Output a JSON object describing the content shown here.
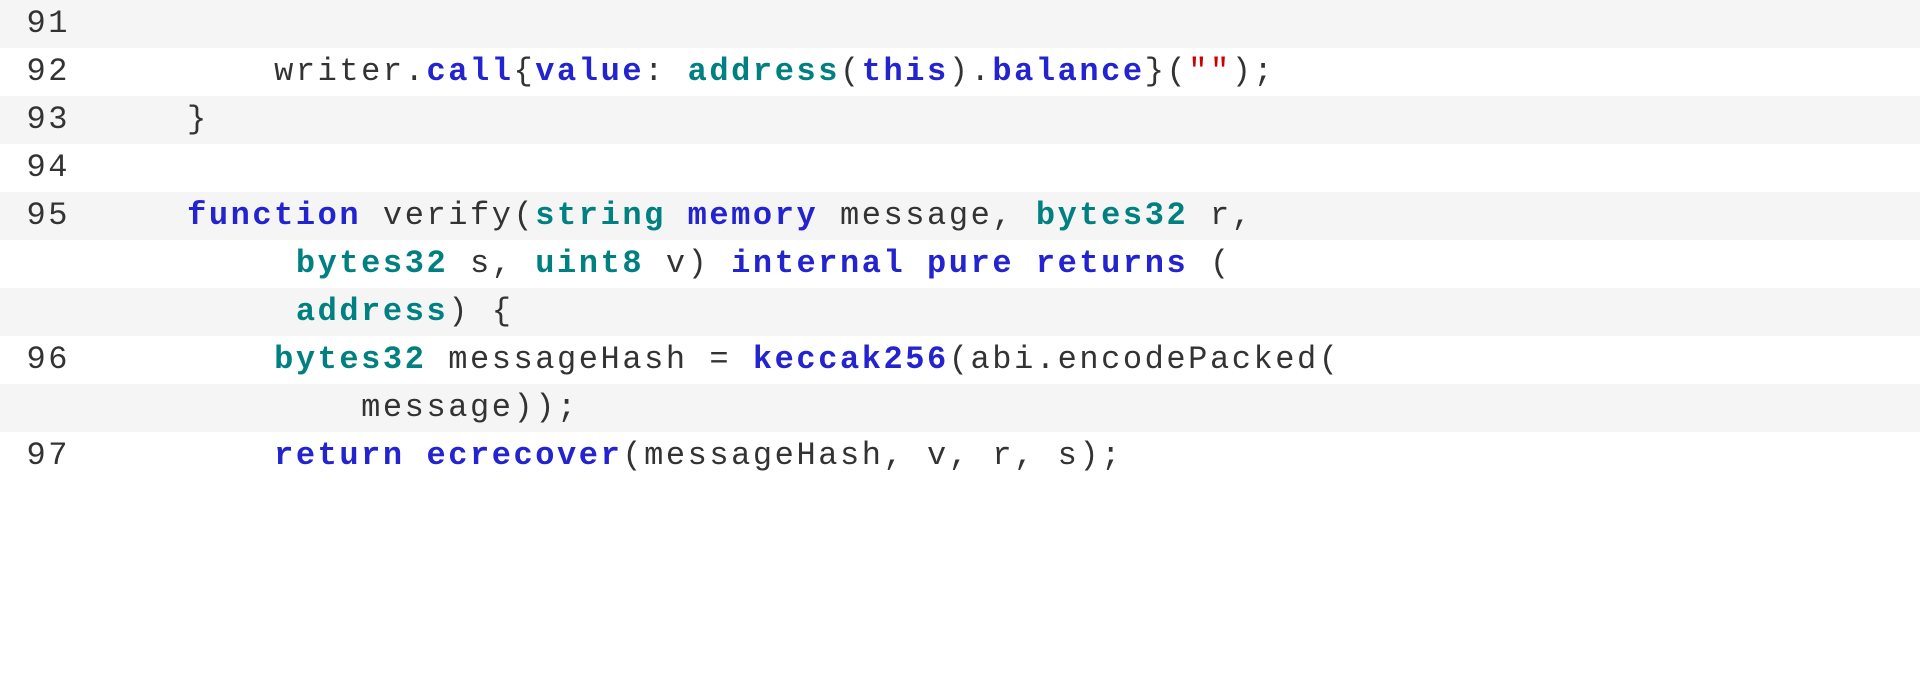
{
  "lines": [
    {
      "num": "91",
      "tokens": [
        {
          "cls": "plain",
          "t": ""
        }
      ]
    },
    {
      "num": "92",
      "tokens": [
        {
          "cls": "plain",
          "t": "        writer."
        },
        {
          "cls": "kw-blue",
          "t": "call"
        },
        {
          "cls": "plain",
          "t": "{"
        },
        {
          "cls": "kw-blue",
          "t": "value"
        },
        {
          "cls": "plain",
          "t": ": "
        },
        {
          "cls": "kw-teal",
          "t": "address"
        },
        {
          "cls": "plain",
          "t": "("
        },
        {
          "cls": "kw-blue",
          "t": "this"
        },
        {
          "cls": "plain",
          "t": ")."
        },
        {
          "cls": "kw-blue",
          "t": "balance"
        },
        {
          "cls": "plain",
          "t": "}("
        },
        {
          "cls": "str",
          "t": "\"\""
        },
        {
          "cls": "plain",
          "t": ");"
        }
      ]
    },
    {
      "num": "93",
      "tokens": [
        {
          "cls": "plain",
          "t": "    }"
        }
      ]
    },
    {
      "num": "94",
      "tokens": [
        {
          "cls": "plain",
          "t": ""
        }
      ]
    },
    {
      "num": "95",
      "tokens": [
        {
          "cls": "plain",
          "t": "    "
        },
        {
          "cls": "kw-blue",
          "t": "function"
        },
        {
          "cls": "plain",
          "t": " verify("
        },
        {
          "cls": "kw-teal",
          "t": "string"
        },
        {
          "cls": "plain",
          "t": " "
        },
        {
          "cls": "kw-blue",
          "t": "memory"
        },
        {
          "cls": "plain",
          "t": " message, "
        },
        {
          "cls": "kw-teal",
          "t": "bytes32"
        },
        {
          "cls": "plain",
          "t": " r,"
        }
      ]
    },
    {
      "num": "",
      "tokens": [
        {
          "cls": "plain",
          "t": "         "
        },
        {
          "cls": "kw-teal",
          "t": "bytes32"
        },
        {
          "cls": "plain",
          "t": " s, "
        },
        {
          "cls": "kw-teal",
          "t": "uint8"
        },
        {
          "cls": "plain",
          "t": " v) "
        },
        {
          "cls": "kw-blue",
          "t": "internal"
        },
        {
          "cls": "plain",
          "t": " "
        },
        {
          "cls": "kw-blue",
          "t": "pure"
        },
        {
          "cls": "plain",
          "t": " "
        },
        {
          "cls": "kw-blue",
          "t": "returns"
        },
        {
          "cls": "plain",
          "t": " ("
        }
      ]
    },
    {
      "num": "",
      "tokens": [
        {
          "cls": "plain",
          "t": "         "
        },
        {
          "cls": "kw-teal",
          "t": "address"
        },
        {
          "cls": "plain",
          "t": ") {"
        }
      ]
    },
    {
      "num": "96",
      "tokens": [
        {
          "cls": "plain",
          "t": "        "
        },
        {
          "cls": "kw-teal",
          "t": "bytes32"
        },
        {
          "cls": "plain",
          "t": " messageHash = "
        },
        {
          "cls": "kw-blue",
          "t": "keccak256"
        },
        {
          "cls": "plain",
          "t": "(abi.encodePacked("
        }
      ]
    },
    {
      "num": "",
      "tokens": [
        {
          "cls": "plain",
          "t": "            message));"
        }
      ]
    },
    {
      "num": "97",
      "tokens": [
        {
          "cls": "plain",
          "t": "        "
        },
        {
          "cls": "kw-blue",
          "t": "return"
        },
        {
          "cls": "plain",
          "t": " "
        },
        {
          "cls": "kw-blue",
          "t": "ecrecover"
        },
        {
          "cls": "plain",
          "t": "(messageHash, v, r, s);"
        }
      ]
    }
  ]
}
